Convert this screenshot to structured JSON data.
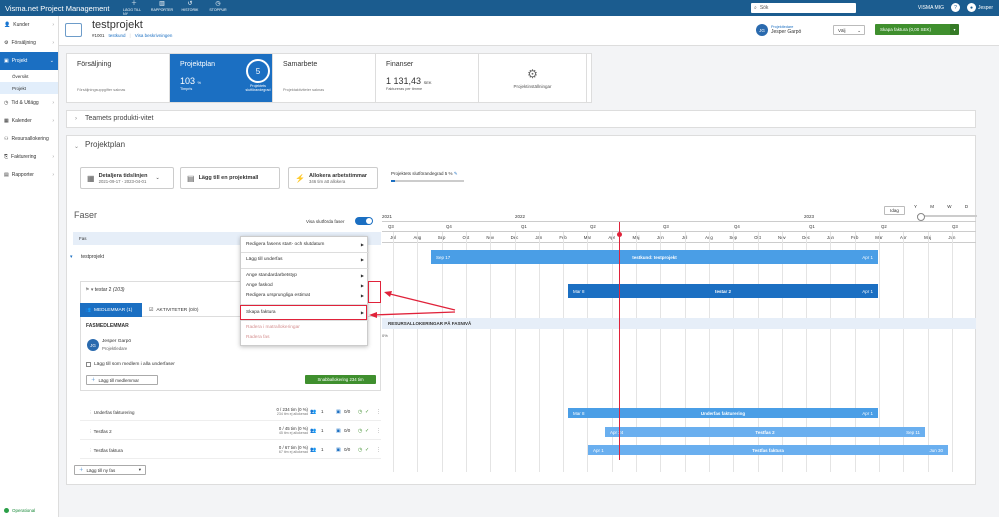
{
  "topbar": {
    "brand": "Visma.net Project Management",
    "nav": [
      {
        "icon": "plus-icon",
        "label": "LÄGG TILL NY"
      },
      {
        "icon": "chart-icon",
        "label": "RAPPORTER"
      },
      {
        "icon": "history-icon",
        "label": "HISTORIK"
      },
      {
        "icon": "clock-icon",
        "label": "STOPPUR"
      }
    ],
    "search_placeholder": "Sök",
    "company": "VISMA MIG",
    "user": "Jesper"
  },
  "sidebar": {
    "items": [
      {
        "label": "Kunder"
      },
      {
        "label": "Försäljning"
      },
      {
        "label": "Projekt"
      },
      {
        "label": "Tid & Utlägg"
      },
      {
        "label": "Kalender"
      },
      {
        "label": "Resursallokering"
      },
      {
        "label": "Fakturering"
      },
      {
        "label": "Rapporter"
      }
    ],
    "subitems": [
      {
        "label": "Översikt"
      },
      {
        "label": "Projekt"
      }
    ],
    "status": "Operational"
  },
  "header": {
    "title": "testprojekt",
    "number": "#1001",
    "customer": "testkund",
    "description_link": "Visa beskrivningen",
    "leader_label": "Projektledare",
    "leader_name": "Jesper Garpö",
    "leader_initials": "JG",
    "choose": "Välj",
    "invoice_button": "Skapa faktura (0,00 SEK)"
  },
  "cards": [
    {
      "title": "Försäljning",
      "note": "Försäljningsuppgifter saknas"
    },
    {
      "title": "Projektplan",
      "value": "103",
      "value_unit": "%",
      "sub": "Timpris",
      "ring_value": "5",
      "ring_label": "Projektets slutförandegrad"
    },
    {
      "title": "Samarbete",
      "note": "Projektaktiviteter saknas"
    },
    {
      "title": "Finanser",
      "value": "1 131,43",
      "value_unit": "SEK",
      "sub": "Faktureras per timme"
    },
    {
      "title": "Projektinställningar"
    }
  ],
  "teamprod": {
    "title": "Teamets produkti-vitet"
  },
  "plan": {
    "title": "Projektplan",
    "btn1_title": "Detaljera tidslinjen",
    "btn1_sub": "2021-09-17 - 2023-04-01",
    "btn2_title": "Lägg till en projektmall",
    "btn3_title": "Allokera arbetstimmar",
    "btn3_sub": "346 tim att allokera",
    "progress_label": "Projektets slutförandegrad 5 %",
    "progress": 0.05
  },
  "faser": {
    "title": "Faser",
    "show_completed": "Visa slutförda faser",
    "col_header": "Fas",
    "project_row": "testprojekt",
    "sub_row": "testar 2",
    "sub_row_hours": "(103)",
    "tab_members": "MEDLEMMAR (1)",
    "tab_activities": "AKTIVITETER (0/0)",
    "members_header": "FASMEDLEMMAR",
    "member_name": "Jesper Garpö",
    "member_role": "Projektledare",
    "member_initials": "JG",
    "add_all_label": "Lägg till som medlem i alla underfaser",
    "add_member": "Lägg till medlemmar",
    "quick_alloc": "Snabballokering 234 tim",
    "resalloc_header": "RESURSALLOKERINGAR PÅ FASNIVÅ",
    "resalloc_pct": "0%",
    "add_phase": "Lägg till ny fas",
    "rows": [
      {
        "name": "Underfas fakturering",
        "hours": "0 / 234 tim (0 %)",
        "sub": "234 tim ej allokerad",
        "members": "1",
        "acts": "0/0"
      },
      {
        "name": "Testfas 2",
        "hours": "0 / 45 tim (0 %)",
        "sub": "45 tim ej allokerad",
        "members": "1",
        "acts": "0/0"
      },
      {
        "name": "Testfas faktura",
        "hours": "0 / 67 tim (0 %)",
        "sub": "67 tim ej allokerad",
        "members": "1",
        "acts": "0/0"
      }
    ]
  },
  "menu": {
    "items": [
      "Redigera fasens start- och slutdatum",
      "Lägg till underfas",
      "Ange standardarbetstyp",
      "Ange faskod",
      "Redigera ursprungliga estimat",
      "Skapa faktura",
      "Radera i matrallokeringar",
      "Radera fas"
    ]
  },
  "timeline": {
    "today_label": "Idag",
    "zoom": [
      "Y",
      "M",
      "W",
      "D"
    ],
    "years": [
      "2021",
      "2022",
      "2023"
    ],
    "quarters": [
      "Q3",
      "Q4",
      "Q1",
      "Q2",
      "Q3",
      "Q4",
      "Q1",
      "Q2",
      "Q3"
    ],
    "months": [
      "Jul",
      "Aug",
      "Sep",
      "Okt",
      "Nov",
      "Dec",
      "Jan",
      "Feb",
      "Mar",
      "Apr",
      "Maj",
      "Jun",
      "Jul",
      "Aug",
      "Sep",
      "Okt",
      "Nov",
      "Dec",
      "Jan",
      "Feb",
      "Mar",
      "Apr",
      "Maj",
      "Jun"
    ],
    "bars": [
      {
        "label": "testkund: testprojekt",
        "start": "Sep 17",
        "end": "Apr 1"
      },
      {
        "label": "testar 2",
        "start": "Mar 8",
        "end": "Apr 1"
      },
      {
        "label": "Underfas fakturering",
        "start": "Mar 8",
        "end": "Apr 1"
      },
      {
        "label": "Testfas 2",
        "start": "Apr 24",
        "end": "Sep 11"
      },
      {
        "label": "Testfas faktura",
        "start": "Apr 1",
        "end": "Jun 30"
      }
    ]
  }
}
